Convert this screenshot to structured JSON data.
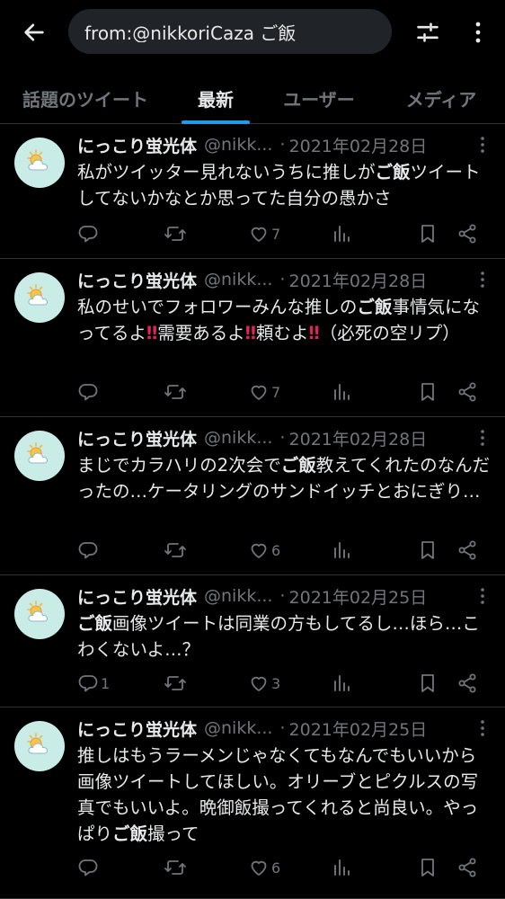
{
  "search": {
    "query": "from:@nikkoriCaza ご飯"
  },
  "tabs": [
    {
      "label": "話題のツイート",
      "active": false
    },
    {
      "label": "最新",
      "active": true
    },
    {
      "label": "ユーザー",
      "active": false
    },
    {
      "label": "メディア",
      "active": false
    }
  ],
  "colors": {
    "accent": "#1d9bf0",
    "background": "#000000",
    "muted": "#71767b",
    "divider": "#2f3336"
  },
  "icons": {
    "back": "arrow-left-icon",
    "filter": "sliders-icon",
    "more": "more-vertical-icon",
    "reply": "reply-icon",
    "retweet": "retweet-icon",
    "like": "heart-icon",
    "views": "views-icon",
    "bookmark": "bookmark-icon",
    "share": "share-icon",
    "avatar": "sun-cloud-icon"
  },
  "tweets": [
    {
      "name": "にっこり蛍光体",
      "handle": "@nikk...",
      "dot": "·",
      "date": "2021年02月28日",
      "text": [
        {
          "t": "私がツイッター見れないうちに推しが"
        },
        {
          "t": "ご飯",
          "s": "b"
        },
        {
          "t": "ツイートしてないかなとか思ってた自分の愚かさ"
        }
      ],
      "replies": "",
      "retweets": "",
      "likes": "7"
    },
    {
      "name": "にっこり蛍光体",
      "handle": "@nikk...",
      "dot": "·",
      "date": "2021年02月28日",
      "text": [
        {
          "t": "私のせいでフォロワーみんな推しの"
        },
        {
          "t": "ご飯",
          "s": "b"
        },
        {
          "t": "事情気になってるよ"
        },
        {
          "t": "‼",
          "s": "ex"
        },
        {
          "t": "需要あるよ"
        },
        {
          "t": "‼",
          "s": "ex"
        },
        {
          "t": "頼むよ"
        },
        {
          "t": "‼",
          "s": "ex"
        },
        {
          "t": "（必死の空リプ）"
        }
      ],
      "replies": "",
      "retweets": "",
      "likes": "7"
    },
    {
      "name": "にっこり蛍光体",
      "handle": "@nikk...",
      "dot": "·",
      "date": "2021年02月28日",
      "text": [
        {
          "t": "まじでカラハリの2次会で"
        },
        {
          "t": "ご飯",
          "s": "b"
        },
        {
          "t": "教えてくれたのなんだったの…ケータリングのサンドイッチとおにぎり…"
        }
      ],
      "replies": "",
      "retweets": "",
      "likes": "6"
    },
    {
      "name": "にっこり蛍光体",
      "handle": "@nikk...",
      "dot": "·",
      "date": "2021年02月25日",
      "text": [
        {
          "t": "ご飯",
          "s": "b"
        },
        {
          "t": "画像ツイートは同業の方もしてるし…ほら…こわくないよ…？"
        }
      ],
      "replies": "1",
      "retweets": "",
      "likes": "3"
    },
    {
      "name": "にっこり蛍光体",
      "handle": "@nikk...",
      "dot": "·",
      "date": "2021年02月25日",
      "text": [
        {
          "t": "推しはもうラーメンじゃなくてもなんでもいいから画像ツイートしてほしい。オリーブとピクルスの写真でもいいよ。晩御飯撮ってくれると尚良い。やっぱり"
        },
        {
          "t": "ご飯",
          "s": "b"
        },
        {
          "t": "撮って"
        }
      ],
      "replies": "",
      "retweets": "",
      "likes": "6"
    }
  ]
}
